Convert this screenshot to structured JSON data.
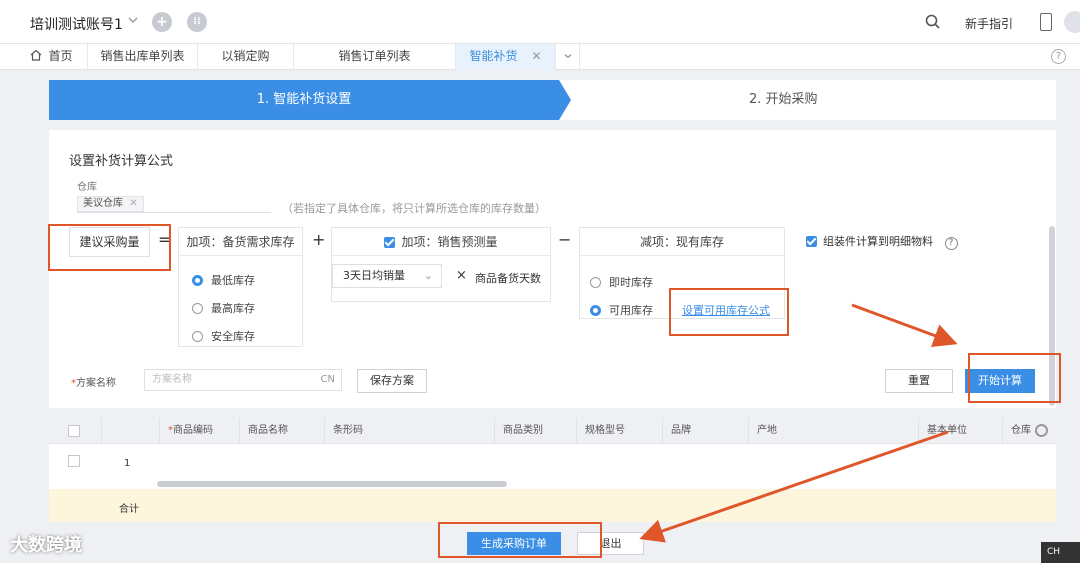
{
  "topbar": {
    "account": "培训测试账号1",
    "guide": "新手指引"
  },
  "tabs": [
    {
      "label": "首页"
    },
    {
      "label": "销售出库单列表"
    },
    {
      "label": "以销定购"
    },
    {
      "label": "销售订单列表"
    },
    {
      "label": "智能补货",
      "active": true
    }
  ],
  "steps": {
    "step1": "1. 智能补货设置",
    "step2": "2. 开始采购"
  },
  "form": {
    "title": "设置补货计算公式",
    "warehouse_label": "仓库",
    "warehouse_chip": "美议仓库",
    "warehouse_hint": "（若指定了具体仓库，将只计算所选仓库的库存数量）",
    "suggest_label": "建议采购量",
    "eq": "=",
    "plus": "+",
    "minus": "−",
    "times": "×",
    "demand_box": {
      "title": "加项：备货需求库存",
      "options": [
        "最低库存",
        "最高库存",
        "安全库存"
      ],
      "selected": 0
    },
    "forecast_box": {
      "title": "加项：销售预测量",
      "checked": true,
      "select_value": "3天日均销量",
      "days_label": "商品备货天数"
    },
    "stock_box": {
      "title": "减项：现有库存",
      "options": [
        "即时库存",
        "可用库存"
      ],
      "selected": 1,
      "link": "设置可用库存公式"
    },
    "assembly": {
      "label": "组装件计算到明细物料",
      "checked": true
    },
    "scheme_label": "方案名称",
    "scheme_placeholder": "方案名称",
    "scheme_lang": "CN",
    "save_scheme": "保存方案",
    "reset": "重置",
    "start": "开始计算"
  },
  "grid": {
    "columns": [
      "商品编码",
      "商品名称",
      "条形码",
      "商品类别",
      "规格型号",
      "品牌",
      "产地",
      "基本单位",
      "仓库"
    ],
    "rows": [
      {
        "num": "1"
      }
    ],
    "total_label": "合计"
  },
  "footer": {
    "generate": "生成采购订单",
    "exit": "退出"
  },
  "watermark": "大数跨境",
  "tray": "CH",
  "colors": {
    "primary": "#3a8ee6",
    "annotation": "#e0562b"
  }
}
